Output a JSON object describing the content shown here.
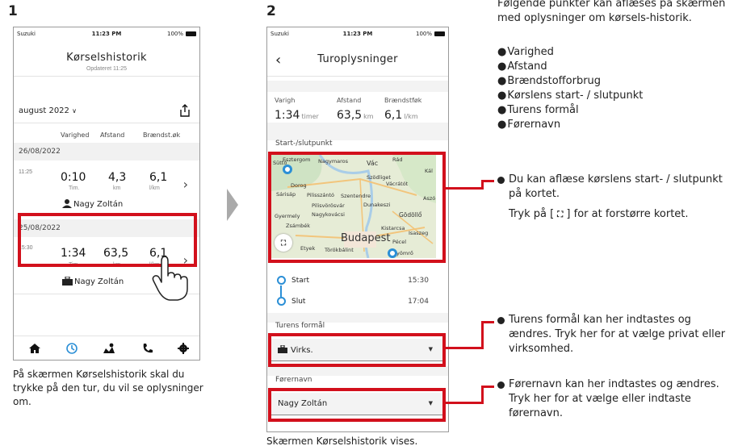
{
  "steps": {
    "one": "1",
    "two": "2"
  },
  "phone1": {
    "status": {
      "carrier": "Suzuki",
      "time": "11:23 PM",
      "battery": "100%"
    },
    "title": "Kørselshistorik",
    "subtitle": "Opdateret 11:25",
    "month": "august 2022",
    "columns": [
      "Varighed",
      "Afstand",
      "Brændst.øk"
    ],
    "groups": [
      {
        "date": "26/08/2022",
        "time": "11:25",
        "duration": "0:10",
        "distance": "4,3",
        "fuel": "6,1",
        "unit_dur": "Tim.",
        "unit_dist": "km",
        "unit_fuel": "l/km",
        "driver": "Nagy Zoltán"
      },
      {
        "date": "25/08/2022",
        "time": "15:30",
        "duration": "1:34",
        "distance": "63,5",
        "fuel": "6,1",
        "unit_dur": "Tim.",
        "unit_dist": "km",
        "unit_fuel": "l/km",
        "driver": "Nagy Zoltán"
      }
    ],
    "tabs": [
      "home-icon",
      "history-icon",
      "map-icon",
      "phone-icon",
      "settings-icon"
    ]
  },
  "phone2": {
    "status": {
      "carrier": "Suzuki",
      "time": "11:23 PM",
      "battery": "100%"
    },
    "title": "Turoplysninger",
    "stats": [
      {
        "label": "Varigh",
        "value": "1:34",
        "unit": "timer"
      },
      {
        "label": "Afstand",
        "value": "63,5",
        "unit": "km"
      },
      {
        "label": "Brændstføk",
        "value": "6,1",
        "unit": "l/km"
      }
    ],
    "route_label": "Start-/slutpunkt",
    "map_labels": [
      "Vác",
      "Szödliget",
      "Vácrátót",
      "Dorog",
      "Pilisszántó",
      "Szentendre",
      "Dunakeszi",
      "Pilisvörösvár",
      "Sárisáp",
      "Gyermely",
      "Nagykovácsi",
      "Gödöllő",
      "Zsámbék",
      "Kistarcsa",
      "Isaszeg",
      "Budapest",
      "Etyek",
      "Törökbálint",
      "Pécel",
      "Gyömrő",
      "Kál",
      "Aszó",
      "Rád",
      "Nagymaros",
      "Esztergom",
      "Süttő"
    ],
    "start_label": "Start",
    "start_time": "15:30",
    "end_label": "Slut",
    "end_time": "17:04",
    "purpose_label": "Turens formål",
    "purpose_value": "Virks.",
    "driver_label": "Førernavn",
    "driver_value": "Nagy Zoltán"
  },
  "captions": {
    "step1": "På skærmen Kørselshistorik skal du trykke på den tur, du vil se oplysninger om.",
    "step2": "Skærmen Kørselshistorik vises."
  },
  "info": {
    "intro": "Følgende punkter kan aflæses på skærmen med oplysninger om kørsels-historik.",
    "items": [
      "Varighed",
      "Afstand",
      "Brændstofforbrug",
      "Kørslens start- / slutpunkt",
      "Turens formål",
      "Førernavn"
    ],
    "note_map": "Du kan aflæse kørslens start- / slutpunkt på kortet.",
    "note_map2": "Tryk på [ ] for at forstørre kortet.",
    "note_purpose": "Turens formål kan her indtastes og ændres. Tryk her for at vælge privat eller virksomhed.",
    "note_driver": "Førernavn kan her indtastes og ændres. Tryk her for at vælge eller indtaste førernavn."
  },
  "colors": {
    "highlight": "#d2101c",
    "accent": "#2b8fd6"
  }
}
